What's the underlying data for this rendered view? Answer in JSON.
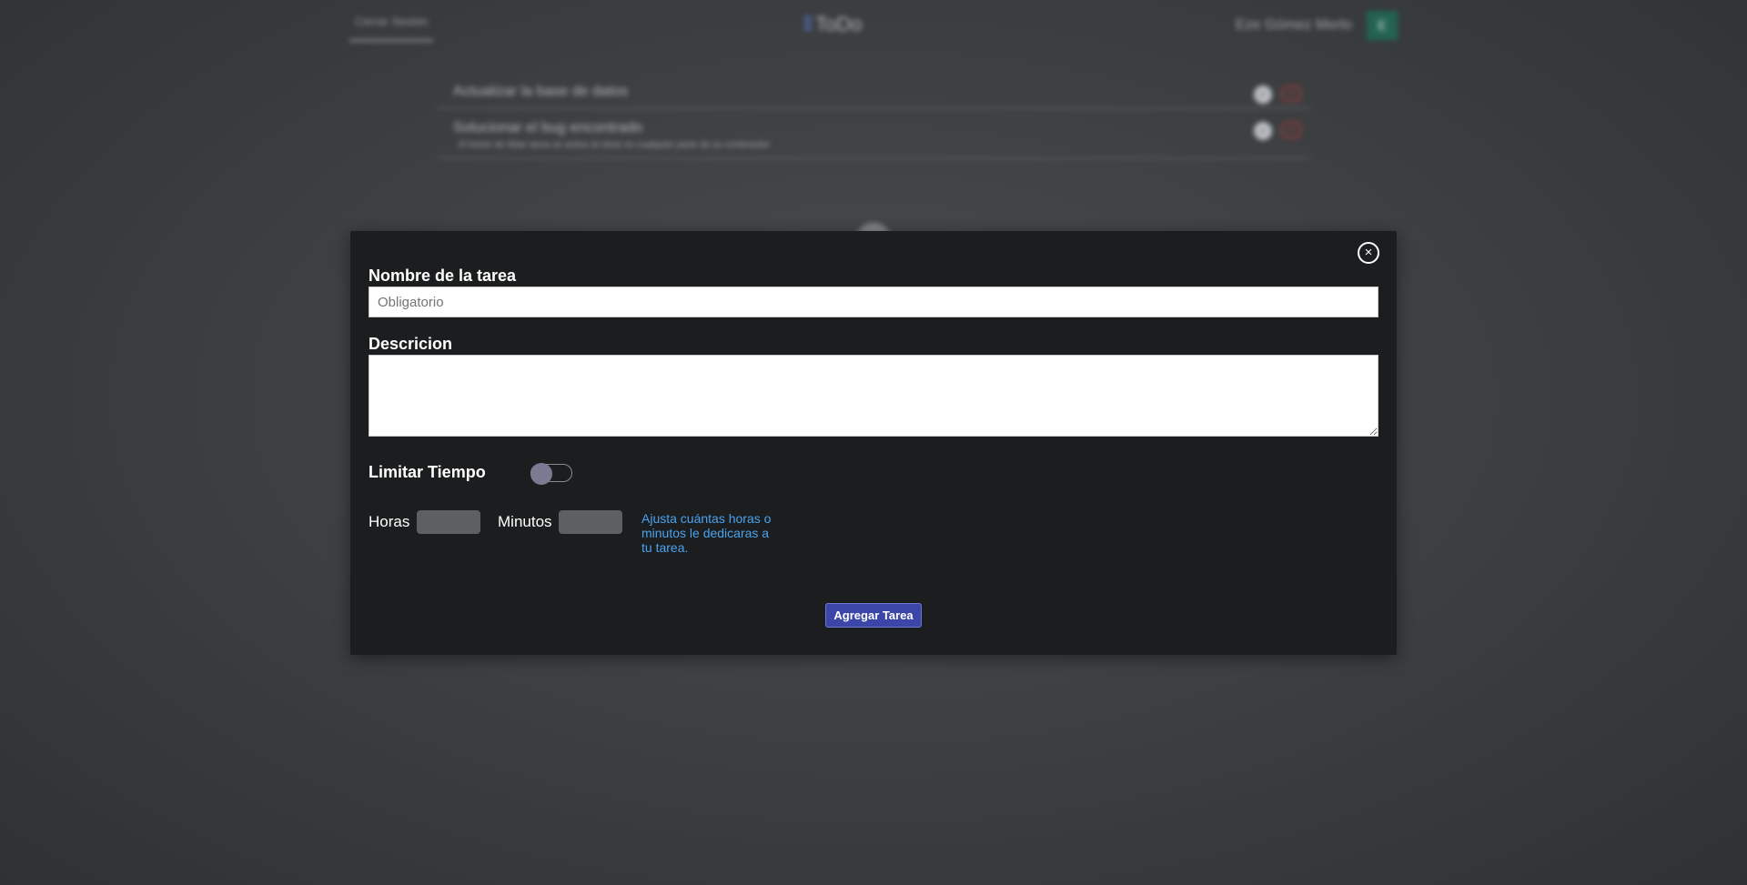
{
  "header": {
    "logout_label": "Cerrar Sesión",
    "brand": "ToDo",
    "user_name": "Eze Gómez Merlo",
    "user_initial": "E"
  },
  "tasks": [
    {
      "title": "Actualizar la base de datos",
      "description": ""
    },
    {
      "title": "Solucionar el bug encontrado",
      "description": "El botón de tildar tarea se activa al clicar en cualquier parte de su contenedor"
    }
  ],
  "modal": {
    "close_symbol": "×",
    "name_label": "Nombre de la tarea",
    "name_placeholder": "Obligatorio",
    "name_value": "",
    "description_label": "Descricion",
    "description_value": "",
    "limit_label": "Limitar Tiempo",
    "limit_enabled": false,
    "hours_label": "Horas",
    "hours_value": "",
    "minutes_label": "Minutos",
    "minutes_value": "",
    "hint": "Ajusta cuántas horas o minutos le dedicaras a tu tarea.",
    "submit_label": "Agregar Tarea"
  },
  "colors": {
    "modal_background": "#1b1d1e",
    "submit_button": "#3c46a8",
    "hint_text": "#4aa3f0",
    "toggle_knob": "#7b7a92",
    "avatar": "#1f6b55"
  },
  "icons": {
    "close": "close-circle-icon",
    "task_done": "check-circle-icon",
    "task_delete": "delete-icon",
    "add_task": "add-circle-icon"
  }
}
